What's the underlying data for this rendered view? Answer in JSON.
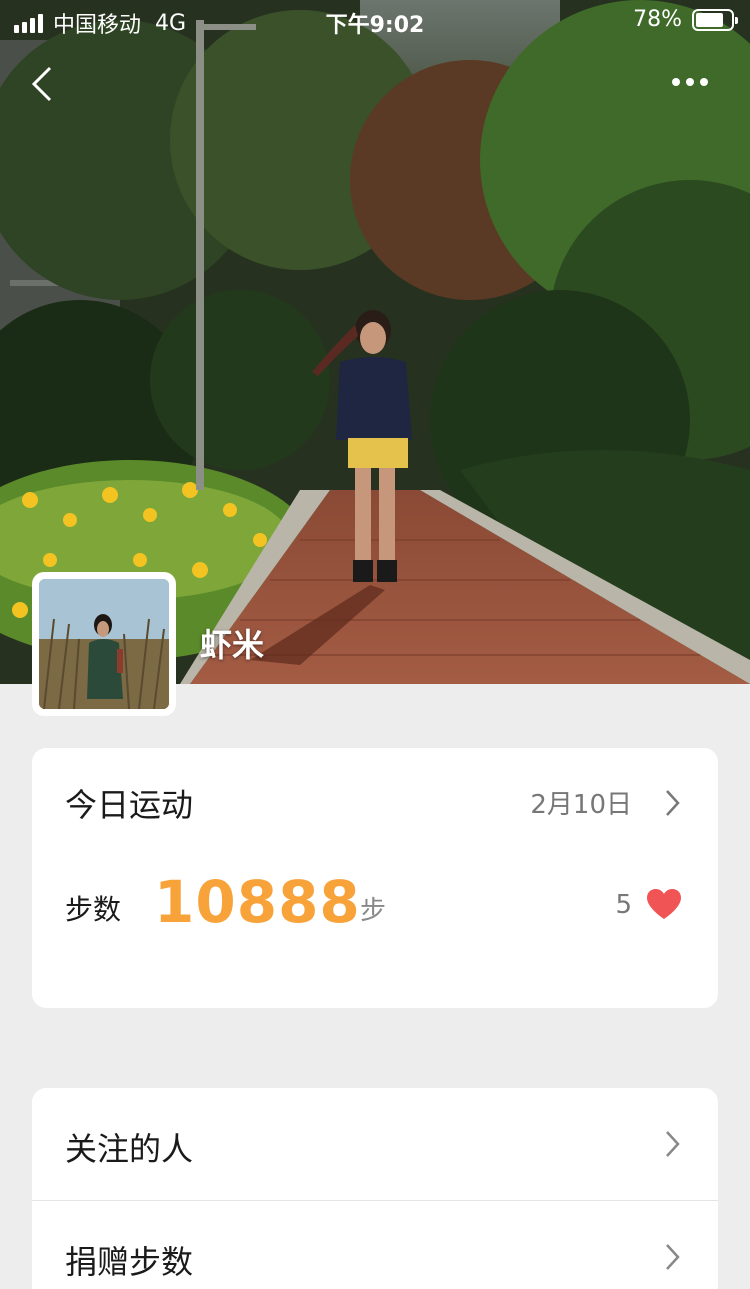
{
  "status_bar": {
    "carrier": "中国移动",
    "network": "4G",
    "time": "下午9:02",
    "battery_percent": "78%",
    "battery_level": 0.78
  },
  "header": {
    "back_icon": "chevron-left-icon",
    "more_icon": "ellipsis-icon"
  },
  "profile": {
    "name": "虾米"
  },
  "sport": {
    "title": "今日运动",
    "date": "2月10日",
    "steps_label": "步数",
    "steps_value": "10888",
    "steps_unit": "步",
    "likes": "5"
  },
  "list": {
    "items": [
      {
        "label": "关注的人"
      },
      {
        "label": "捐赠步数"
      }
    ]
  },
  "colors": {
    "accent_orange": "#f7a33a",
    "heart_red": "#f05454",
    "page_bg": "#ededed"
  }
}
